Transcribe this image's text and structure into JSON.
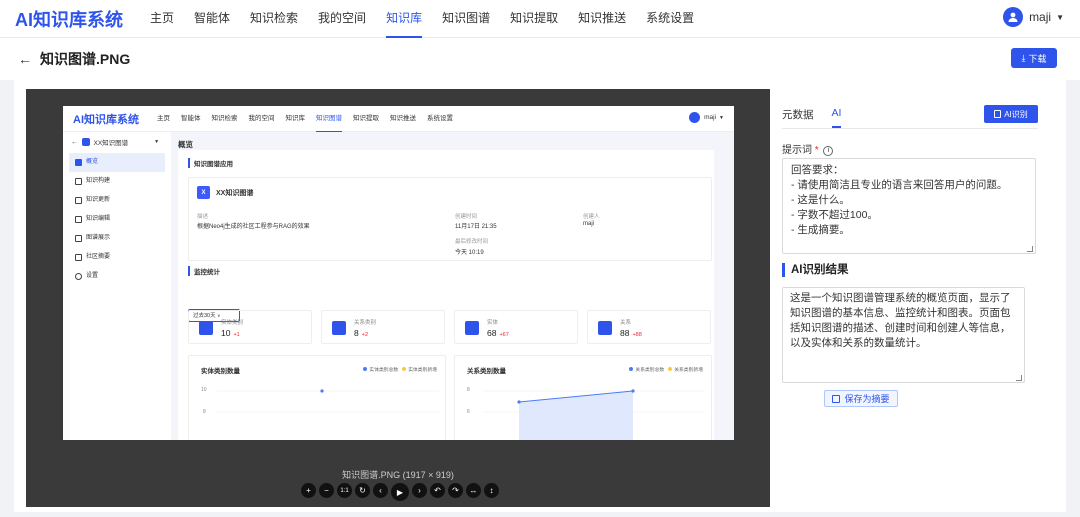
{
  "app": {
    "logo": "AI知识库系统"
  },
  "nav": {
    "items": [
      "主页",
      "智能体",
      "知识检索",
      "我的空间",
      "知识库",
      "知识图谱",
      "知识提取",
      "知识推送",
      "系统设置"
    ],
    "active_index": 4
  },
  "user": {
    "name": "maji"
  },
  "page": {
    "title": "知识图谱.PNG",
    "download_label": "下载"
  },
  "viewer": {
    "caption": "知识图谱.PNG (1917 × 919)",
    "toolbar": [
      "+",
      "−",
      "1:1",
      "↻",
      "‹",
      "▶",
      "›",
      "↶",
      "↷",
      "↔",
      "↕"
    ]
  },
  "inner": {
    "logo": "AI知识库系统",
    "nav": [
      "主页",
      "智能体",
      "知识检索",
      "我的空间",
      "知识库",
      "知识图谱",
      "知识提取",
      "知识推送",
      "系统设置"
    ],
    "nav_active_index": 5,
    "user": "maji",
    "kb_select": "XX知识图谱",
    "side": [
      "概览",
      "知识构建",
      "知识更新",
      "知识编辑",
      "图谱展示",
      "社区摘要",
      "设置"
    ],
    "heading": "概览",
    "app_section": "知识图谱应用",
    "kg_name": "XX知识图谱",
    "desc_label": "描述",
    "desc_value": "根据Neo4j生成的社区工程参与RAG的效果",
    "created_label": "创建时间",
    "created_value": "11月17日 21:35",
    "creator_label": "创建人",
    "creator_value": "maji",
    "modified_label": "最后修改时间",
    "modified_value": "今天 10:19",
    "monitor_section": "监控统计",
    "range_select": "过去30天",
    "stats": [
      {
        "label": "实体类别",
        "value": "10",
        "delta": "+1"
      },
      {
        "label": "关系类别",
        "value": "8",
        "delta": "+2"
      },
      {
        "label": "实体",
        "value": "68",
        "delta": "+67"
      },
      {
        "label": "关系",
        "value": "88",
        "delta": "+88"
      }
    ],
    "chart1": {
      "title": "实体类别数量",
      "legend_a": "实体类别总数",
      "legend_b": "实体类别新增",
      "y_top": "10",
      "y_bottom": "8"
    },
    "chart2": {
      "title": "关系类别数量",
      "legend_a": "关系类别总数",
      "legend_b": "关系类别新增",
      "y_top": "8",
      "y_bottom": "6"
    }
  },
  "panel": {
    "tabs": [
      "元数据",
      "AI"
    ],
    "active_tab": 1,
    "ai_button": "AI识别",
    "prompt_label": "提示词",
    "prompt_text": "回答要求：\n- 请使用简洁且专业的语言来回答用户的问题。\n- 这是什么。\n- 字数不超过100。\n- 生成摘要。",
    "result_title": "AI识别结果",
    "result_text": "这是一个知识图谱管理系统的概览页面，显示了知识图谱的基本信息、监控统计和图表。页面包括知识图谱的描述、创建时间和创建人等信息，以及实体和关系的数量统计。",
    "save_button": "保存为摘要"
  },
  "colors": {
    "accent": "#2f54eb",
    "delta": "#f5222d",
    "viewer_bg": "#3a3a3a"
  }
}
